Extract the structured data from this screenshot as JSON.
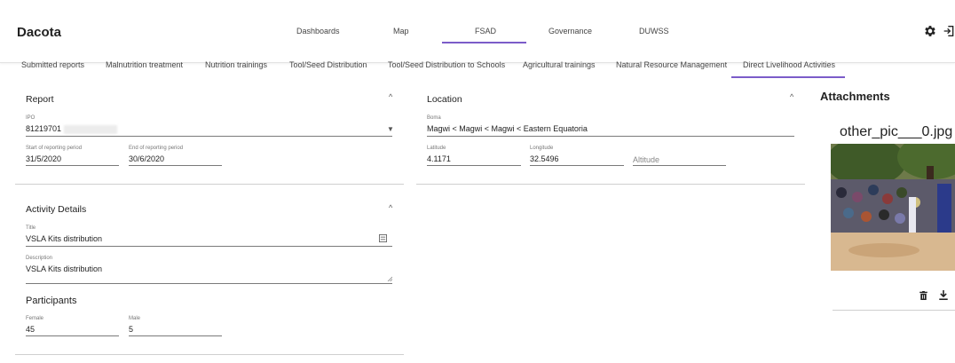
{
  "app": {
    "title": "Dacota"
  },
  "nav": {
    "items": [
      "Dashboards",
      "Map",
      "FSAD",
      "Governance",
      "DUWSS"
    ],
    "active": "FSAD"
  },
  "subnav": {
    "items": [
      "Submitted reports",
      "Malnutrition treatment",
      "Nutrition trainings",
      "Tool/Seed Distribution",
      "Tool/Seed Distribution to Schools",
      "Agricultural trainings",
      "Natural Resource Management",
      "Direct Livelihood Activities"
    ],
    "active": "Direct Livelihood Activities"
  },
  "report": {
    "title": "Report",
    "ipo_label": "IPO",
    "ipo_value": "81219701",
    "start_label": "Start of reporting period",
    "start_value": "31/5/2020",
    "end_label": "End of reporting period",
    "end_value": "30/6/2020"
  },
  "location": {
    "title": "Location",
    "boma_label": "Boma",
    "boma_value": "Magwi < Magwi < Magwi < Eastern Equatoria",
    "lat_label": "Latitude",
    "lat_value": "4.1171",
    "lon_label": "Longitude",
    "lon_value": "32.5496",
    "alt_placeholder": "Altitude"
  },
  "activity": {
    "title": "Activity Details",
    "title_label": "Title",
    "title_value": "VSLA Kits distribution",
    "desc_label": "Description",
    "desc_value": "VSLA Kits distribution"
  },
  "participants": {
    "title": "Participants",
    "female_label": "Female",
    "female_value": "45",
    "male_label": "Male",
    "male_value": "5"
  },
  "attachments": {
    "title": "Attachments",
    "filename": "other_pic___0.jpg"
  }
}
